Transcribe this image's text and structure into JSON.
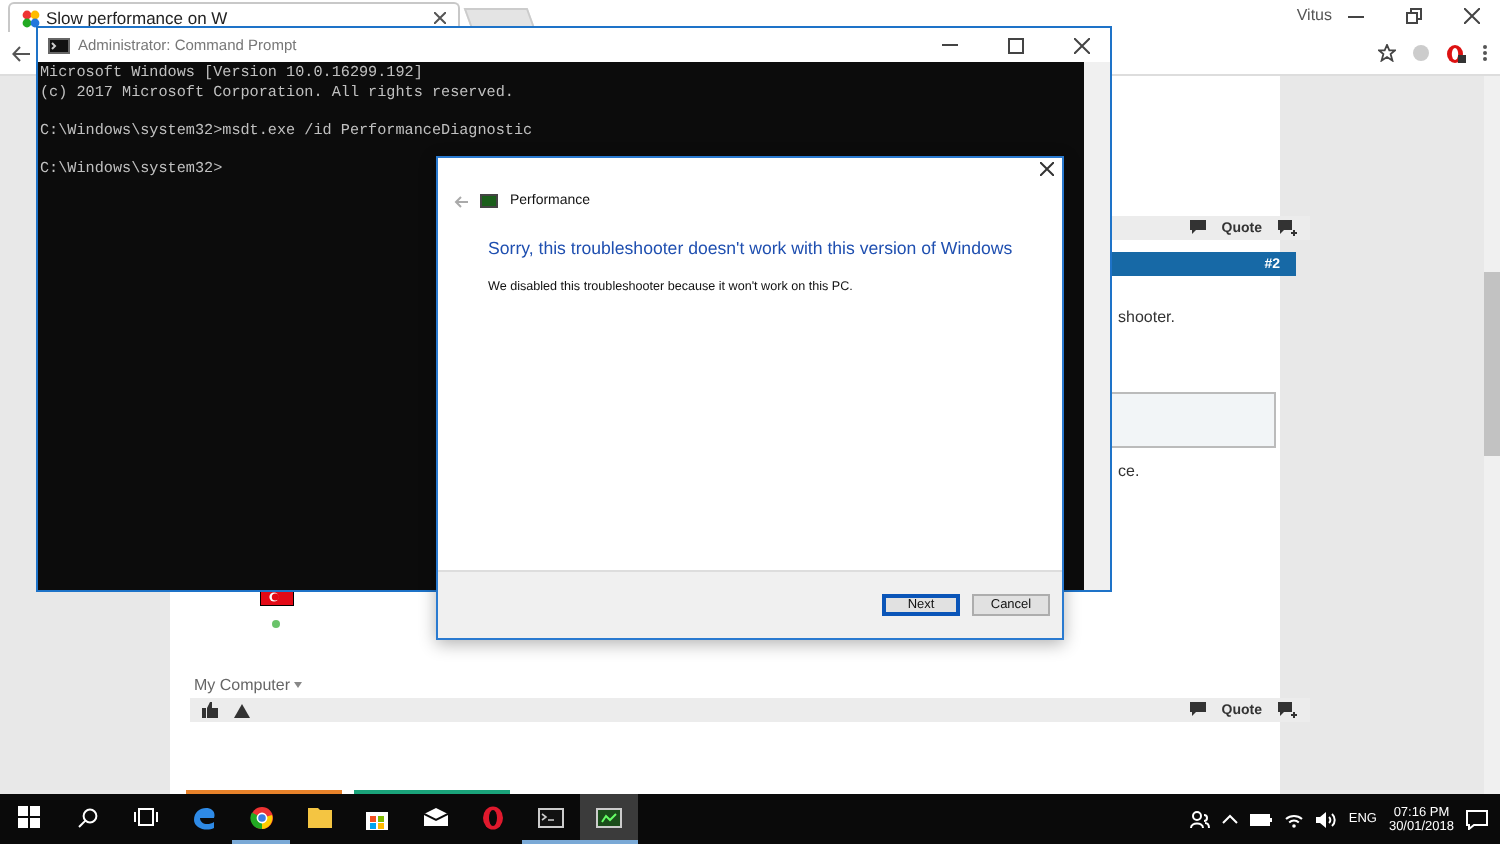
{
  "browser": {
    "tab_title": "Slow performance on W",
    "user": "Vitus"
  },
  "forum": {
    "quote_label": "Quote",
    "post_number": "#2",
    "fragment_1": "shooter.",
    "fragment_2": "ce.",
    "my_computer": "My Computer",
    "footer_quote": "Quote"
  },
  "cmd": {
    "title": "Administrator: Command Prompt",
    "paragraphs": [
      {
        "lines": [
          "Microsoft Windows [Version 10.0.16299.192]",
          "(c) 2017 Microsoft Corporation. All rights reserved."
        ]
      },
      {
        "lines": [
          "C:\\Windows\\system32>msdt.exe /id PerformanceDiagnostic"
        ]
      },
      {
        "lines": [
          "C:\\Windows\\system32>"
        ]
      }
    ]
  },
  "dialog": {
    "title": "Performance",
    "heading": "Sorry, this troubleshooter doesn't work with this version of Windows",
    "message": "We disabled this troubleshooter because it won't work on this PC.",
    "buttons": [
      {
        "label": "Next",
        "default": true
      },
      {
        "label": "Cancel",
        "default": false
      }
    ]
  },
  "taskbar": {
    "apps": [
      {
        "kind": "edge",
        "running": false,
        "selected": false
      },
      {
        "kind": "chrome",
        "running": true,
        "selected": false
      },
      {
        "kind": "folder",
        "running": false,
        "selected": false
      },
      {
        "kind": "store",
        "running": false,
        "selected": false
      },
      {
        "kind": "mail",
        "running": false,
        "selected": false
      },
      {
        "kind": "opera",
        "running": false,
        "selected": false
      },
      {
        "kind": "console",
        "running": true,
        "selected": false
      },
      {
        "kind": "troubleshooter",
        "running": true,
        "selected": true
      }
    ],
    "language": "ENG",
    "time": "07:16 PM",
    "date": "30/01/2018"
  }
}
